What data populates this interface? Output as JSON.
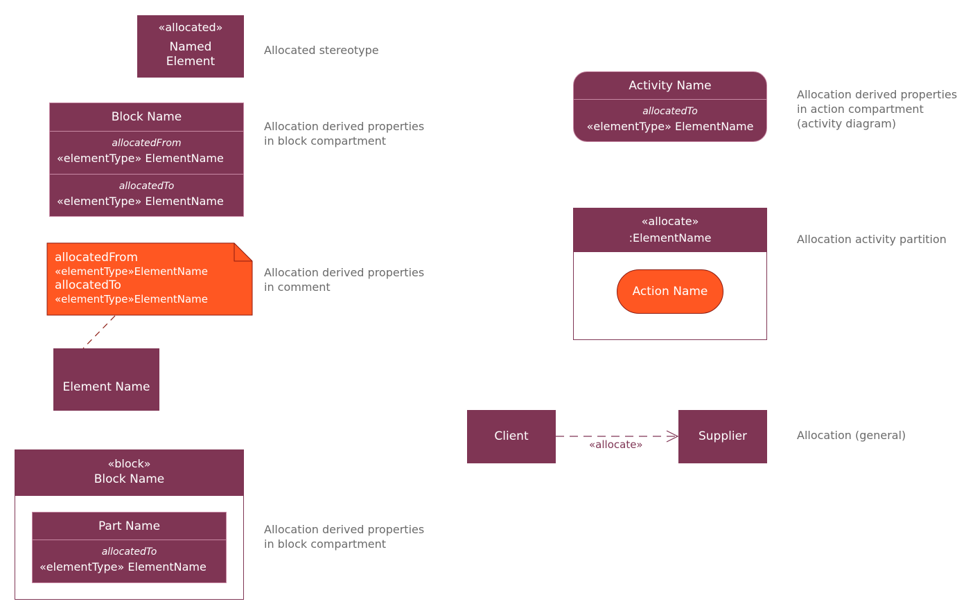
{
  "colors": {
    "shape_fill": "#7f3554",
    "shape_text": "#ffffff",
    "accent_fill": "#ff5722",
    "accent_border": "#8b1a10",
    "description_text": "#6a6a6a",
    "connector": "#7f3554"
  },
  "allocated_stereotype": {
    "stereotype": "«allocated»",
    "name_line1": "Named",
    "name_line2": "Element",
    "description": "Allocated stereotype"
  },
  "block_compartment": {
    "title": "Block Name",
    "from_label": "allocatedFrom",
    "from_value": "«elementType» ElementName",
    "to_label": "allocatedTo",
    "to_value": "«elementType» ElementName",
    "description": "Allocation derived properties\nin block compartment"
  },
  "comment": {
    "line1": "allocatedFrom",
    "line2": "«elementType»ElementName",
    "line3": "allocatedTo",
    "line4": "«elementType»ElementName",
    "element_name": "Element Name",
    "description": "Allocation derived properties\nin comment"
  },
  "block_part": {
    "stereotype": "«block»",
    "title": "Block Name",
    "part_title": "Part Name",
    "to_label": "allocatedTo",
    "to_value": "«elementType» ElementName",
    "description": "Allocation derived properties\nin block compartment"
  },
  "activity": {
    "title": "Activity Name",
    "to_label": "allocatedTo",
    "to_value": "«elementType» ElementName",
    "description": "Allocation derived properties\nin action compartment\n(activity diagram)"
  },
  "partition": {
    "stereotype": "«allocate»",
    "name": ":ElementName",
    "action": "Action Name",
    "description": "Allocation activity partition"
  },
  "general": {
    "client": "Client",
    "supplier": "Supplier",
    "relation_label": "«allocate»",
    "description": "Allocation (general)"
  }
}
